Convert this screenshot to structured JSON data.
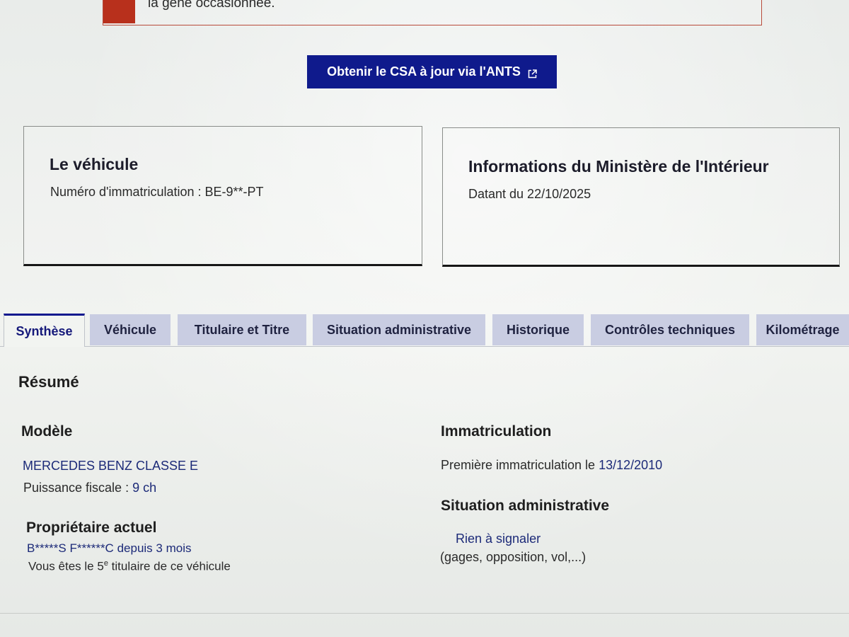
{
  "alert": {
    "text": "la gêne occasionnée."
  },
  "ants_button": {
    "label": "Obtenir le CSA à jour via l'ANTS",
    "icon": "external-link-icon"
  },
  "vehicle_card": {
    "title": "Le véhicule",
    "registration": "Numéro d'immatriculation : BE-9**-PT"
  },
  "ministry_card": {
    "title": "Informations du Ministère de l'Intérieur",
    "date": "Datant du 22/10/2025"
  },
  "tabs": [
    {
      "label": "Synthèse",
      "active": true
    },
    {
      "label": "Véhicule",
      "active": false
    },
    {
      "label": "Titulaire et Titre",
      "active": false
    },
    {
      "label": "Situation administrative",
      "active": false
    },
    {
      "label": "Historique",
      "active": false
    },
    {
      "label": "Contrôles techniques",
      "active": false
    },
    {
      "label": "Kilométrage",
      "active": false
    }
  ],
  "summary": {
    "title": "Résumé",
    "model": {
      "heading": "Modèle",
      "name": "MERCEDES BENZ CLASSE E",
      "fiscal_power_label": "Puissance fiscale : ",
      "fiscal_power_value": "9 ch"
    },
    "owner": {
      "heading": "Propriétaire actuel",
      "name": "B*****S F******C",
      "since": "depuis 3 mois",
      "holder_prefix": "Vous êtes le 5",
      "holder_sup": "e",
      "holder_suffix": " titulaire de ce véhicule"
    },
    "registration": {
      "heading": "Immatriculation",
      "first_label": "Première immatriculation le ",
      "first_date": "13/12/2010"
    },
    "admin": {
      "heading": "Situation administrative",
      "status": "Rien à signaler",
      "details": "(gages, opposition, vol,...)"
    }
  },
  "colors": {
    "primary": "#0f1a8c",
    "alert": "#b8301c",
    "tab_inactive": "#c9cde2"
  }
}
